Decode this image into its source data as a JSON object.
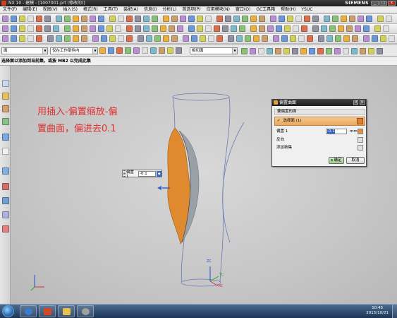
{
  "window": {
    "title": "NX 10 - 建模 - [1007001.prt (修改的)]",
    "brand": "SIEMENS",
    "controls": [
      "_",
      "□",
      "x"
    ]
  },
  "menu": {
    "items": [
      "文件(F)",
      "编辑(E)",
      "视图(V)",
      "插入(S)",
      "格式(R)",
      "工具(T)",
      "装配(A)",
      "信息(I)",
      "分析(L)",
      "首选项(P)",
      "应用模块(N)",
      "窗口(O)",
      "GC工具箱",
      "帮助(H)",
      "YSUC"
    ]
  },
  "toolbar": {
    "filter_combo": "面",
    "scope_combo": "仅在工作部件内",
    "snap_combo": "相切面"
  },
  "prompt": {
    "text": "选择面以添加到当前集，或按 MB2 以完成此集"
  },
  "annotation": {
    "line1": "用插入-偏置缩放-偏",
    "line2": "置曲面，偏进去0.1"
  },
  "offset_float": {
    "label": "偏置 1",
    "value": "-0.1"
  },
  "dialog": {
    "title": "偏置曲面",
    "section_title": "要偏置的面",
    "select_label": "选择面 (1)",
    "offset_label": "偏置 1",
    "offset_value": "-0.1",
    "unit": "mm",
    "reverse_label": "反向",
    "add_set_label": "添加新集",
    "ok_label": "确定",
    "cancel_label": "取消"
  },
  "axes": {
    "zc": "ZC",
    "xc": "XC",
    "yc": "YC"
  },
  "taskbar": {
    "time": "10:45",
    "date": "2015/10/21"
  },
  "colors": {
    "annotation": "#e03030",
    "face_orange": "#e08a30",
    "face_gray": "#9aa0a8",
    "wire_blue": "#6a7ab8",
    "ok_green": "#9ccc8c"
  }
}
